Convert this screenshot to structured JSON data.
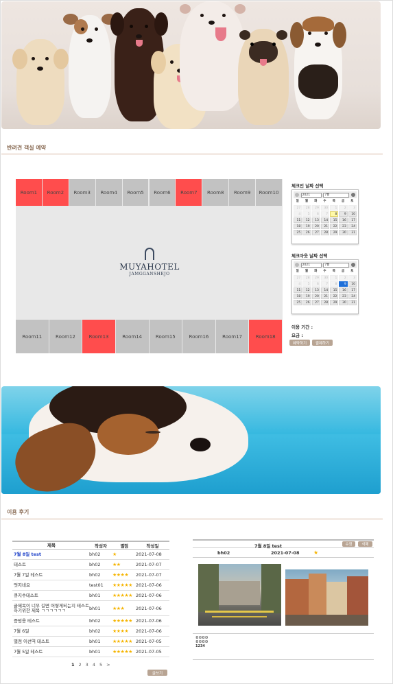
{
  "section_reservation": {
    "title": "반려견 객실 예약"
  },
  "section_reviews": {
    "title": "이용 후기"
  },
  "rooms_top": [
    {
      "label": "Room1",
      "booked": true
    },
    {
      "label": "Room2",
      "booked": true
    },
    {
      "label": "Room3",
      "booked": false
    },
    {
      "label": "Room4",
      "booked": false
    },
    {
      "label": "Room5",
      "booked": false
    },
    {
      "label": "Room6",
      "booked": false
    },
    {
      "label": "Room7",
      "booked": true
    },
    {
      "label": "Room8",
      "booked": false
    },
    {
      "label": "Room9",
      "booked": false
    },
    {
      "label": "Room10",
      "booked": false
    }
  ],
  "rooms_bottom": [
    {
      "label": "Room11",
      "booked": false
    },
    {
      "label": "Room12",
      "booked": false
    },
    {
      "label": "Room13",
      "booked": true
    },
    {
      "label": "Room14",
      "booked": false
    },
    {
      "label": "Room15",
      "booked": false
    },
    {
      "label": "Room16",
      "booked": false
    },
    {
      "label": "Room17",
      "booked": false
    },
    {
      "label": "Room18",
      "booked": true
    }
  ],
  "hotel": {
    "name": "MUYAHOTEL",
    "sub": "JAMGGANSHEJO"
  },
  "checkin": {
    "label": "체크인 날짜 선택",
    "year": "2021",
    "month": "7월",
    "highlight_day": "8",
    "highlight_type": "today"
  },
  "checkout": {
    "label": "체크아웃 날짜 선택",
    "year": "2021",
    "month": "7월",
    "highlight_day": "9",
    "highlight_type": "selected"
  },
  "calendar": {
    "weekdays": [
      "일",
      "월",
      "화",
      "수",
      "목",
      "금",
      "토"
    ],
    "weeks": [
      [
        "27",
        "28",
        "29",
        "30",
        "1",
        "2",
        "3"
      ],
      [
        "4",
        "5",
        "6",
        "7",
        "8",
        "9",
        "10"
      ],
      [
        "11",
        "12",
        "13",
        "14",
        "15",
        "16",
        "17"
      ],
      [
        "18",
        "19",
        "20",
        "21",
        "22",
        "23",
        "24"
      ],
      [
        "25",
        "26",
        "27",
        "28",
        "29",
        "30",
        "31"
      ]
    ]
  },
  "booking_info": {
    "period_label": "이용 기간 :",
    "price_label": "요금 :",
    "reserve_button": "예약하기",
    "pay_button": "결제하기"
  },
  "review_list": {
    "headers": [
      "제목",
      "작성자",
      "별점",
      "작성일"
    ],
    "rows": [
      {
        "title": "7월 8일 test",
        "author": "bh02",
        "stars": "★",
        "date": "2021-07-08",
        "highlight": true
      },
      {
        "title": "테스트",
        "author": "bh02",
        "stars": "★★",
        "date": "2021-07-07"
      },
      {
        "title": "7월 7일 테스트",
        "author": "bh02",
        "stars": "★★★★",
        "date": "2021-07-07"
      },
      {
        "title": "멋지네요",
        "author": "test01",
        "stars": "★★★★★",
        "date": "2021-07-06"
      },
      {
        "title": "큐지수테스트",
        "author": "bh01",
        "stars": "★★★★★",
        "date": "2021-07-06"
      },
      {
        "title": "글제목이 너무 길면 어떻게되는지 테스트하기위한 제목 ㄱㄱㄱㄱㄱㄱ",
        "author": "bh01",
        "stars": "★★★",
        "date": "2021-07-06"
      },
      {
        "title": "증빙용 테스트",
        "author": "bh02",
        "stars": "★★★★★",
        "date": "2021-07-06"
      },
      {
        "title": "7월 6일",
        "author": "bh02",
        "stars": "★★★★",
        "date": "2021-07-06"
      },
      {
        "title": "별점 이선역 테스트",
        "author": "bh01",
        "stars": "★★★★★",
        "date": "2021-07-05"
      },
      {
        "title": "7월 5일 테스트",
        "author": "bh01",
        "stars": "★★★★★",
        "date": "2021-07-05"
      }
    ],
    "pages": [
      "1",
      "2",
      "3",
      "4",
      "5",
      ">"
    ],
    "write_button": "글쓰기"
  },
  "review_detail": {
    "title": "7월 8일 test",
    "edit_button": "수정",
    "delete_button": "삭제",
    "author": "bh02",
    "date": "2021-07-08",
    "stars": "★",
    "body_line1": "ㅁㅁㅁㅁ",
    "body_line2": "ㅁㅁㅁㅁ",
    "body_line3": "1234"
  },
  "colors": {
    "booked": "#ff4d4d",
    "available": "#c2c2c2",
    "accent_tan": "#b8a493",
    "section_title": "#8a6c55",
    "star": "#f5b400"
  }
}
